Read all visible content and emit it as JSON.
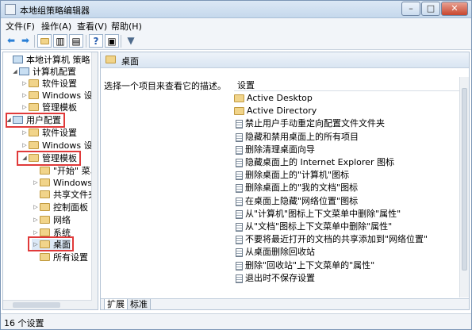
{
  "window": {
    "title": "本地组策略编辑器",
    "controls": {
      "minimize": "–",
      "maximize": "□",
      "close": "✕"
    }
  },
  "menu": [
    "文件(F)",
    "操作(A)",
    "查看(V)",
    "帮助(H)"
  ],
  "toolbar": {
    "icons": [
      "back-arrow",
      "forward-arrow",
      "up-folder",
      "show-hide-tree",
      "properties",
      "help",
      "show-pane",
      "filter"
    ]
  },
  "tree": {
    "root": "本地计算机 策略",
    "computer_config": "计算机配置",
    "cc_software": "软件设置",
    "cc_windows": "Windows 设置",
    "cc_admin": "管理模板",
    "user_config": "用户配置",
    "uc_software": "软件设置",
    "uc_windows": "Windows 设置",
    "uc_admin": "管理模板",
    "start_menu": "\"开始\" 菜单",
    "windows_components": "Windows 组",
    "shared_folders": "共享文件夹",
    "control_panel": "控制面板",
    "network": "网络",
    "system": "系统",
    "desktop": "桌面",
    "all_settings": "所有设置"
  },
  "right_pane": {
    "header": "桌面",
    "description": "选择一个项目来查看它的描述。",
    "column": "设置",
    "items": [
      {
        "label": "Active Desktop",
        "type": "folder"
      },
      {
        "label": "Active Directory",
        "type": "folder"
      },
      {
        "label": "禁止用户手动重定向配置文件文件夹",
        "type": "policy"
      },
      {
        "label": "隐藏和禁用桌面上的所有项目",
        "type": "policy"
      },
      {
        "label": "删除清理桌面向导",
        "type": "policy"
      },
      {
        "label": "隐藏桌面上的 Internet Explorer 图标",
        "type": "policy"
      },
      {
        "label": "删除桌面上的\"计算机\"图标",
        "type": "policy"
      },
      {
        "label": "删除桌面上的\"我的文档\"图标",
        "type": "policy"
      },
      {
        "label": "在桌面上隐藏\"网络位置\"图标",
        "type": "policy"
      },
      {
        "label": "从\"计算机\"图标上下文菜单中删除\"属性\"",
        "type": "policy"
      },
      {
        "label": "从\"文档\"图标上下文菜单中删除\"属性\"",
        "type": "policy"
      },
      {
        "label": "不要将最近打开的文档的共享添加到\"网络位置\"",
        "type": "policy"
      },
      {
        "label": "从桌面删除回收站",
        "type": "policy"
      },
      {
        "label": "删除\"回收站\"上下文菜单的\"属性\"",
        "type": "policy"
      },
      {
        "label": "退出时不保存设置",
        "type": "policy"
      }
    ],
    "tabs": [
      "扩展",
      "标准"
    ]
  },
  "status": "16 个设置",
  "colors": {
    "highlight_box": "#e03a3a",
    "folder": "#f1d48a",
    "titlebar": "#dce8f5"
  }
}
